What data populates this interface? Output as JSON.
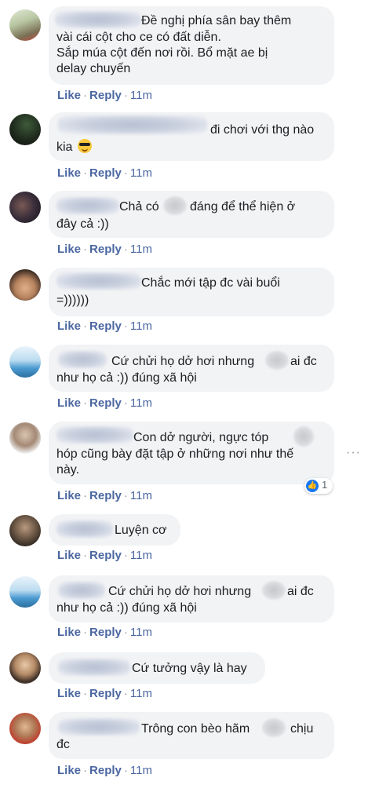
{
  "actions": {
    "like": "Like",
    "reply": "Reply",
    "separator": "·"
  },
  "comments": [
    {
      "lines": [
        "Đề nghị phía sân bay thêm",
        "vài cái cột cho ce có đất diễn.",
        "Sắp múa cột đến nơi rồi. Bổ mặt ae bị",
        "delay chuyến"
      ],
      "time": "11m"
    },
    {
      "lines": [
        "đi chơi với thg nào",
        "kia"
      ],
      "time": "11m",
      "emoji": "smiling-face-with-sunglasses-icon"
    },
    {
      "lines": [
        "Chả có",
        "đáng để thể hiện ở",
        "đây cả :))"
      ],
      "time": "11m"
    },
    {
      "lines": [
        "Chắc mới tập đc vài buổi",
        "=))))))"
      ],
      "time": "11m"
    },
    {
      "lines": [
        "Cứ chửi họ dở hơi nhưng",
        "ai đc",
        "như họ cả :)) đúng xã hội"
      ],
      "time": "11m"
    },
    {
      "lines": [
        "Con dở người, ngực tóp",
        "hóp cũng bày đặt tập ở những nơi như thế",
        "này."
      ],
      "time": "11m",
      "reaction_count": "1"
    },
    {
      "lines": [
        "Luyện cơ"
      ],
      "time": "11m"
    },
    {
      "lines": [
        "Cứ chửi họ dở hơi nhưng",
        "ai đc",
        "như họ cả :)) đúng xã hội"
      ],
      "time": "11m"
    },
    {
      "lines": [
        "Cứ tưởng vậy là hay"
      ],
      "time": "11m"
    },
    {
      "lines": [
        "Trông con bèo hãm",
        "chịu",
        "đc"
      ],
      "time": "11m"
    }
  ],
  "more_options_icon": "···",
  "like_icon": "👍"
}
